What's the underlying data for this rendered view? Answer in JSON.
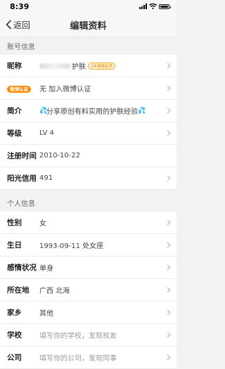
{
  "status_bar": {
    "time": "8:39"
  },
  "nav": {
    "back_label": "返回",
    "title": "编辑资料"
  },
  "account_section": {
    "header": "账号信息",
    "rows": [
      {
        "label": "昵称",
        "value": "护肤",
        "member_badge": "5年微博会员"
      },
      {
        "badge": "微博认证",
        "value": "无 加入微博认证"
      },
      {
        "label": "简介",
        "value": "分享原创有料实用的护肤经验"
      },
      {
        "label": "等级",
        "value": "LV 4"
      },
      {
        "label": "注册时间",
        "value": "2010-10-22"
      },
      {
        "label": "阳光信用",
        "value": "491"
      }
    ]
  },
  "personal_section": {
    "header": "个人信息",
    "rows": [
      {
        "label": "性别",
        "value": "女"
      },
      {
        "label": "生日",
        "value": "1993-09-11 处女座"
      },
      {
        "label": "感情状况",
        "value": "单身"
      },
      {
        "label": "所在地",
        "value": "广西 北海"
      },
      {
        "label": "家乡",
        "value": "其他"
      },
      {
        "label": "学校",
        "placeholder": "填写你的学校，发现校友"
      },
      {
        "label": "公司",
        "placeholder": "填写你的公司，发现同事"
      }
    ]
  },
  "colors": {
    "accent_orange": "#ff8a00",
    "drop_blue": "#4aa3df"
  }
}
